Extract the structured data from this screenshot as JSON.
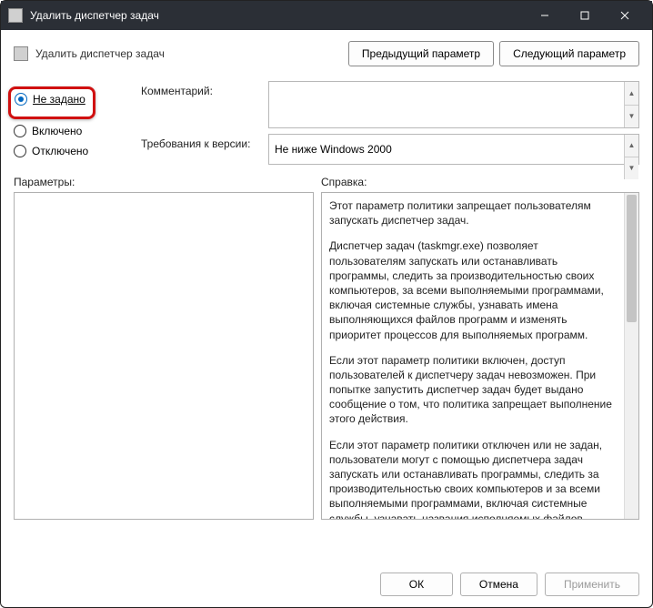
{
  "window": {
    "title": "Удалить диспетчер задач"
  },
  "header": {
    "title": "Удалить диспетчер задач",
    "prev": "Предыдущий параметр",
    "next": "Следующий параметр"
  },
  "radios": {
    "not_configured": "Не задано",
    "enabled": "Включено",
    "disabled": "Отключено"
  },
  "fields": {
    "comment_label": "Комментарий:",
    "comment_value": "",
    "supported_label": "Требования к версии:",
    "supported_value": "Не ниже Windows 2000"
  },
  "panes": {
    "options_label": "Параметры:",
    "help_label": "Справка:",
    "help_paragraphs": [
      "Этот параметр политики запрещает пользователям запускать диспетчер задач.",
      "Диспетчер задач (taskmgr.exe) позволяет пользователям запускать или останавливать программы, следить за производительностью своих компьютеров, за всеми выполняемыми программами, включая системные службы, узнавать имена выполняющихся файлов программ и изменять приоритет процессов для выполняемых программ.",
      "Если этот параметр политики включен, доступ пользователей к диспетчеру задач невозможен. При попытке запустить диспетчер задач будет выдано сообщение о том, что политика запрещает выполнение этого действия.",
      "Если этот параметр политики отключен или не задан, пользователи могут с помощью диспетчера задач запускать или останавливать программы, следить за производительностью своих компьютеров и за всеми выполняемыми программами, включая системные службы, узнавать названия исполняемых файлов программ и"
    ]
  },
  "buttons": {
    "ok": "ОК",
    "cancel": "Отмена",
    "apply": "Применить"
  }
}
